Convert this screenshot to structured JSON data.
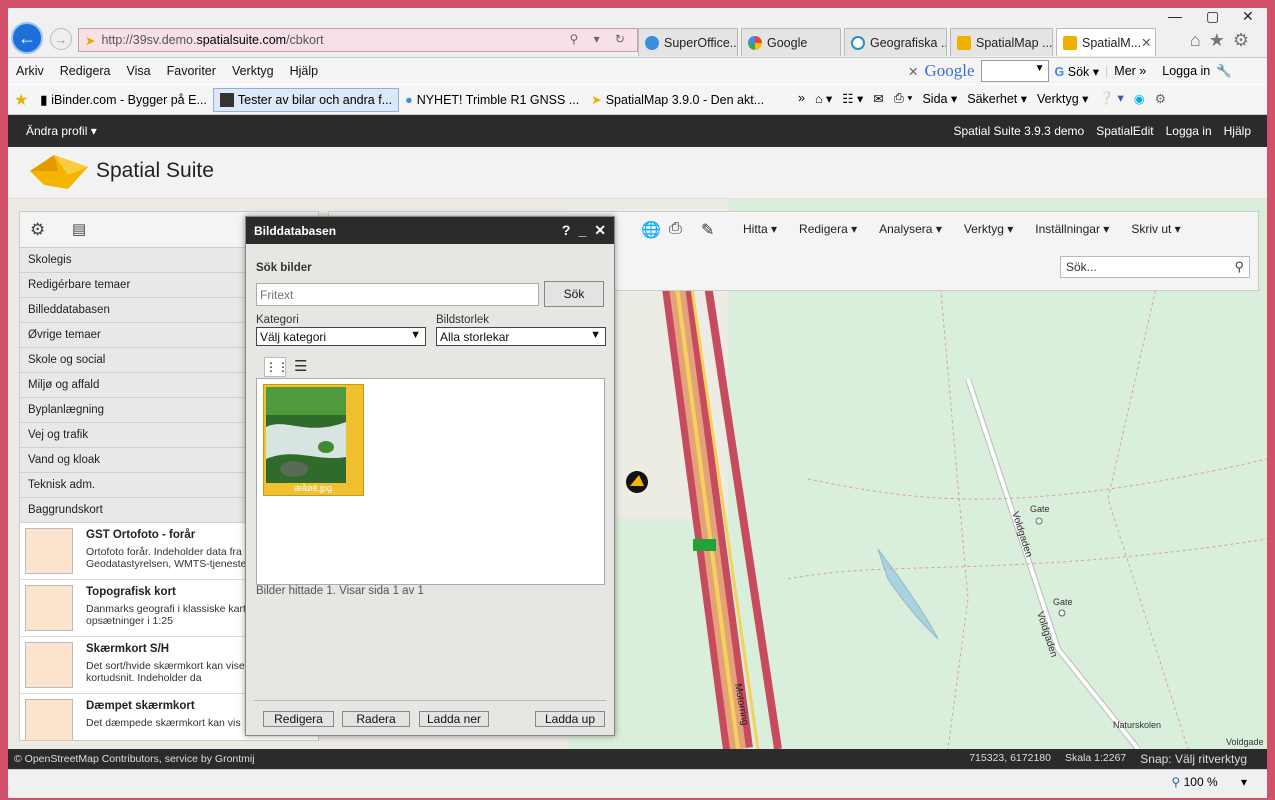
{
  "browser": {
    "address_prefix": "http://39sv.demo.",
    "address_domain": "spatialsuite.com",
    "address_suffix": "/cbkort",
    "tabs": [
      {
        "label": "SuperOffice..."
      },
      {
        "label": "Google"
      },
      {
        "label": "Geografiska ..."
      },
      {
        "label": "SpatialMap ..."
      },
      {
        "label": "SpatialM...",
        "active": true
      }
    ],
    "menu": [
      "Arkiv",
      "Redigera",
      "Visa",
      "Favoriter",
      "Verktyg",
      "Hjälp"
    ],
    "google_brand": "Google",
    "google_buttons": [
      "Sök",
      "Mer",
      "Logga in"
    ],
    "favorites": [
      {
        "label": "iBinder.com - Bygger på E..."
      },
      {
        "label": "Tester av bilar och andra f..."
      },
      {
        "label": "NYHET! Trimble R1 GNSS ..."
      },
      {
        "label": "SpatialMap 3.9.0 - Den akt..."
      }
    ],
    "command_bar": [
      "Sida",
      "Säkerhet",
      "Verktyg"
    ],
    "zoom": "100 %"
  },
  "app": {
    "profile_menu": "Ändra profil",
    "top_links": [
      "Spatial Suite 3.9.3 demo",
      "SpatialEdit",
      "Logga in",
      "Hjälp"
    ],
    "logo_text": "Spatial Suite",
    "toolbar_menus": [
      "Hitta",
      "Redigera",
      "Analysera",
      "Verktyg",
      "Inställningar",
      "Skriv ut"
    ],
    "search_placeholder": "Sök...",
    "footer_left": "© OpenStreetMap Contributors, service by Grontmij",
    "footer_coords": "715323, 6172180",
    "footer_scale": "Skala 1:2267",
    "footer_snap": "Snap: Välj ritverktyg"
  },
  "left_panel": {
    "themes": [
      "Skolegis",
      "Redigérbare temaer",
      "Billeddatabasen",
      "Øvrige temaer",
      "Skole og social",
      "Miljø og affald",
      "Byplanlægning",
      "Vej og trafik",
      "Vand og kloak",
      "Teknisk adm.",
      "Baggrundskort"
    ],
    "cards": [
      {
        "title": "GST Ortofoto - forår",
        "desc": "Ortofoto forår. Indeholder data fra Geodatastyrelsen, WMTS-tjeneste"
      },
      {
        "title": "Topografisk kort",
        "desc": "Danmarks geografi i klassiske kartografiske opsætninger i 1:25"
      },
      {
        "title": "Skærmkort S/H",
        "desc": "Det sort/hvide skærmkort kan vises ved alle kortudsnit. Indeholder da"
      },
      {
        "title": "Dæmpet skærmkort",
        "desc": "Det dæmpede skærmkort kan vis"
      }
    ]
  },
  "dialog": {
    "title": "Bilddatabasen",
    "search_heading": "Sök bilder",
    "fritext_placeholder": "Fritext",
    "search_button": "Sök",
    "kategori_label": "Kategori",
    "kategori_value": "Välj kategori",
    "bildstorlek_label": "Bildstorlek",
    "bildstorlek_value": "Alla storlekar",
    "thumb_caption": "æåøé.jpg",
    "result_text": "Bilder hittade 1. Visar sida 1 av 1",
    "buttons": [
      "Redigera",
      "Radera",
      "Ladda ner",
      "Ladda up"
    ]
  },
  "map_labels": [
    "Voldgaden",
    "Voldgaden",
    "Gate",
    "Gate",
    "Naturskolen",
    "Motorring",
    "Voldgade"
  ]
}
